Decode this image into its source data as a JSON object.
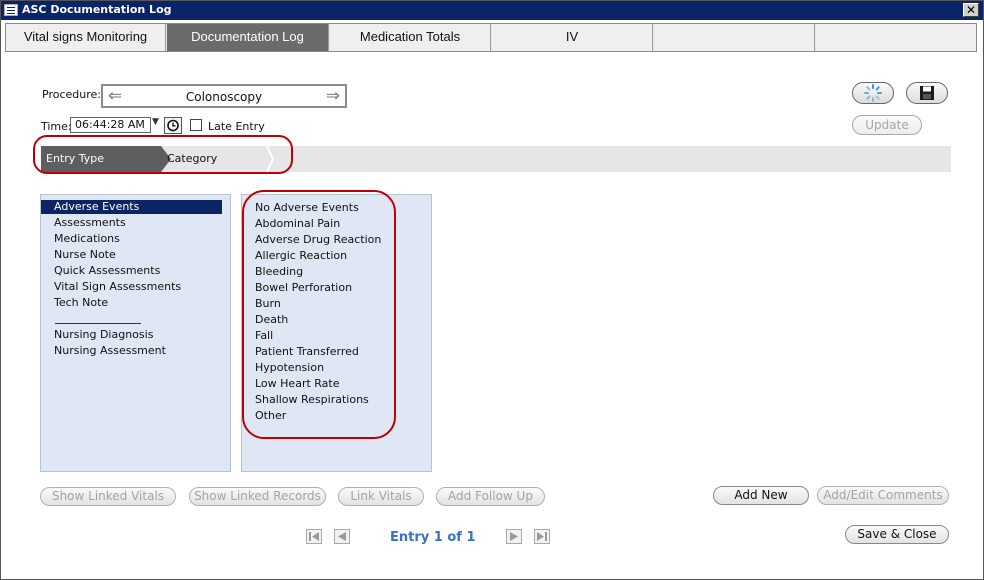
{
  "window": {
    "title": "ASC Documentation Log",
    "close_label": "✕"
  },
  "tabs": [
    {
      "label": "Vital signs Monitoring"
    },
    {
      "label": "Documentation Log"
    },
    {
      "label": "Medication Totals"
    },
    {
      "label": "IV"
    },
    {
      "label": ""
    },
    {
      "label": ""
    }
  ],
  "procedure": {
    "label": "Procedure:",
    "value": "Colonoscopy",
    "prev_icon": "arrow-left-icon",
    "next_icon": "arrow-right-icon"
  },
  "time": {
    "label": "Time:",
    "value": "06:44:28 AM",
    "late_entry_label": "Late Entry",
    "late_entry_checked": false
  },
  "actions": {
    "update_label": "Update",
    "refresh_icon": "spinner-icon",
    "save_icon": "floppy-disk-icon"
  },
  "breadcrumb": {
    "step1": "Entry Type",
    "step2": "Category"
  },
  "entry_types": {
    "items": [
      "Adverse Events",
      "Assessments",
      "Medications",
      "Nurse Note",
      "Quick Assessments",
      "Vital Sign Assessments",
      "Tech Note",
      "",
      "Nursing Diagnosis",
      "Nursing Assessment"
    ],
    "selected": "Adverse Events"
  },
  "categories": {
    "items": [
      "No Adverse Events",
      "Abdominal Pain",
      "Adverse Drug Reaction",
      "Allergic Reaction",
      "Bleeding",
      "Bowel Perforation",
      "Burn",
      "Death",
      "Fall",
      "Patient Transferred",
      "Hypotension",
      "Low Heart Rate",
      "Shallow Respirations",
      "Other"
    ]
  },
  "bottom_buttons": {
    "show_linked_vitals": "Show Linked Vitals",
    "show_linked_records": "Show Linked Records",
    "link_vitals": "Link Vitals",
    "add_follow_up": "Add Follow Up",
    "add_new": "Add New",
    "add_edit_comments": "Add/Edit Comments",
    "save_close": "Save & Close"
  },
  "pager": {
    "label": "Entry 1 of 1"
  },
  "colors": {
    "highlight_oval": "#c00000",
    "selection": "#0b2463",
    "list_bg": "#dfe7f4",
    "active_tab": "#6b6b6b",
    "pager_text": "#3a72c0"
  }
}
